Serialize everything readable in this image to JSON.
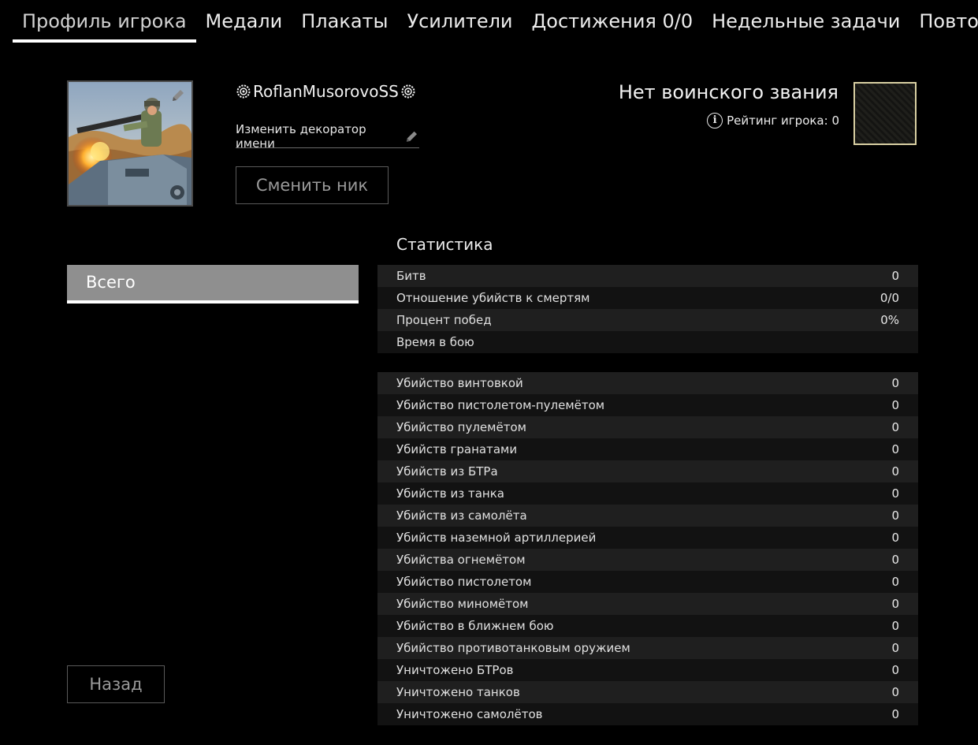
{
  "tabs": [
    {
      "label": "Профиль игрока",
      "active": true
    },
    {
      "label": "Медали"
    },
    {
      "label": "Плакаты"
    },
    {
      "label": "Усилители"
    },
    {
      "label": "Достижения 0/0"
    },
    {
      "label": "Недельные задачи"
    },
    {
      "label": "Повторы"
    }
  ],
  "profile": {
    "nickname": "RoflanMusorovoSS",
    "nickname_decoration_icon": "gear-wreath-icon",
    "change_decorator_label": "Изменить декоратор имени",
    "rename_button": "Сменить ник",
    "rank_title": "Нет воинского звания",
    "rating_text": "Рейтинг игрока: 0",
    "rank_emblem_border": "#d8cfa2"
  },
  "filters": {
    "selected": "Всего"
  },
  "stats": {
    "title": "Статистика",
    "general": [
      {
        "label": "Битв",
        "value": "0"
      },
      {
        "label": "Отношение убийств к смертям",
        "value": "0/0"
      },
      {
        "label": "Процент побед",
        "value": "0%"
      },
      {
        "label": "Время в бою",
        "value": ""
      }
    ],
    "kills": [
      {
        "label": "Убийство винтовкой",
        "value": "0"
      },
      {
        "label": "Убийство пистолетом-пулемётом",
        "value": "0"
      },
      {
        "label": "Убийство пулемётом",
        "value": "0"
      },
      {
        "label": "Убийств гранатами",
        "value": "0"
      },
      {
        "label": "Убийств из БТРа",
        "value": "0"
      },
      {
        "label": "Убийств из танка",
        "value": "0"
      },
      {
        "label": "Убийств из самолёта",
        "value": "0"
      },
      {
        "label": "Убийств наземной артиллерией",
        "value": "0"
      },
      {
        "label": "Убийства огнемётом",
        "value": "0"
      },
      {
        "label": "Убийство пистолетом",
        "value": "0"
      },
      {
        "label": "Убийство миномётом",
        "value": "0"
      },
      {
        "label": "Убийство в ближнем бою",
        "value": "0"
      },
      {
        "label": "Убийство противотанковым оружием",
        "value": "0"
      },
      {
        "label": "Уничтожено БТРов",
        "value": "0"
      },
      {
        "label": "Уничтожено танков",
        "value": "0"
      },
      {
        "label": "Уничтожено самолётов",
        "value": "0"
      }
    ]
  },
  "back_button": "Назад"
}
